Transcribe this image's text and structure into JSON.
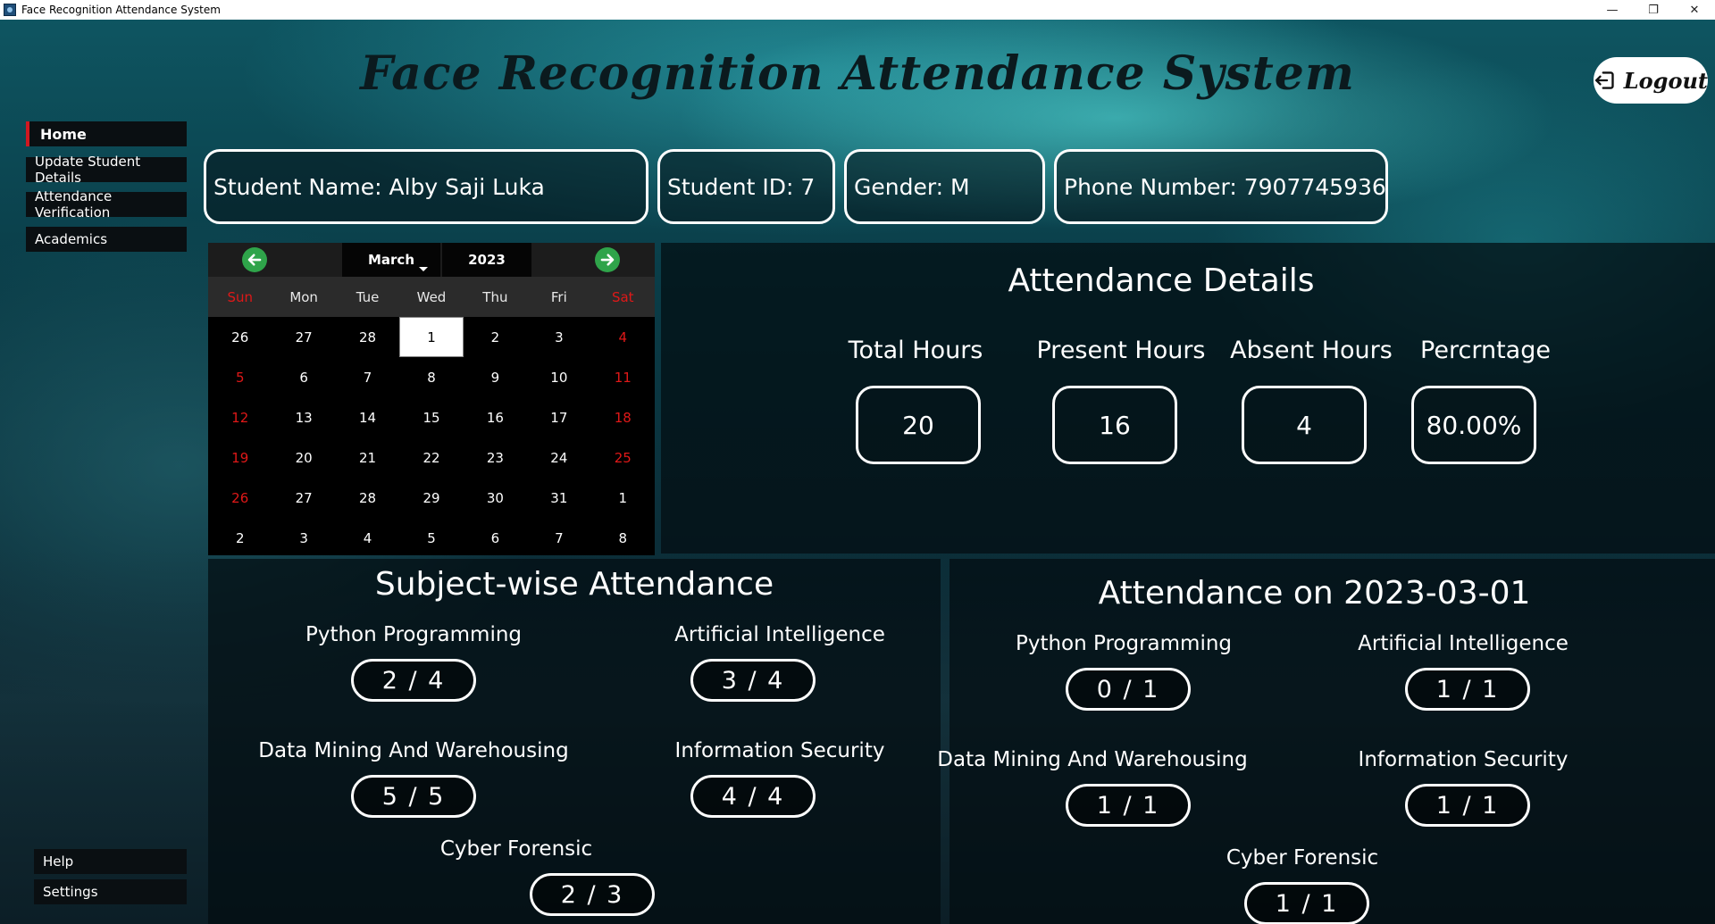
{
  "window": {
    "title": "Face Recognition Attendance System",
    "controls": [
      "—",
      "❐",
      "✕"
    ]
  },
  "header": {
    "title": "Face Recognition Attendance System",
    "logout_label": "Logout"
  },
  "sidebar": {
    "items": [
      {
        "label": "Home",
        "active": true
      },
      {
        "label": "Update Student Details"
      },
      {
        "label": "Attendance Verification"
      },
      {
        "label": "Academics"
      }
    ],
    "bottom": [
      {
        "label": "Help"
      },
      {
        "label": "Settings"
      }
    ]
  },
  "student": {
    "name": "Student Name: Alby Saji Luka",
    "id": "Student ID: 7",
    "gender": "Gender: M",
    "phone": "Phone Number: 7907745936"
  },
  "calendar": {
    "month": "March",
    "year": "2023",
    "weekdays": [
      "Sun",
      "Mon",
      "Tue",
      "Wed",
      "Thu",
      "Fri",
      "Sat"
    ],
    "selected": "1",
    "weeks": [
      [
        "26",
        "27",
        "28",
        "1",
        "2",
        "3",
        "4"
      ],
      [
        "5",
        "6",
        "7",
        "8",
        "9",
        "10",
        "11"
      ],
      [
        "12",
        "13",
        "14",
        "15",
        "16",
        "17",
        "18"
      ],
      [
        "19",
        "20",
        "21",
        "22",
        "23",
        "24",
        "25"
      ],
      [
        "26",
        "27",
        "28",
        "29",
        "30",
        "31",
        "1"
      ],
      [
        "2",
        "3",
        "4",
        "5",
        "6",
        "7",
        "8"
      ]
    ],
    "weekend_color": "#e01818"
  },
  "attendance": {
    "title": "Attendance Details",
    "total_label": "Total Hours",
    "present_label": "Present Hours",
    "absent_label": "Absent Hours",
    "percent_label": "Percrntage",
    "total": "20",
    "present": "16",
    "absent": "4",
    "percent": "80.00%"
  },
  "subject_wise": {
    "title": "Subject-wise Attendance",
    "subjects": [
      {
        "name": "Python Programming",
        "value": "2 / 4"
      },
      {
        "name": "Artificial Intelligence",
        "value": "3 / 4"
      },
      {
        "name": "Data Mining And Warehousing",
        "value": "5 / 5"
      },
      {
        "name": "Information Security",
        "value": "4 / 4"
      },
      {
        "name": "Cyber Forensic",
        "value": "2 / 3"
      }
    ]
  },
  "daily": {
    "title": "Attendance on 2023-03-01",
    "subjects": [
      {
        "name": "Python Programming",
        "value": "0 / 1"
      },
      {
        "name": "Artificial Intelligence",
        "value": "1 / 1"
      },
      {
        "name": "Data Mining And Warehousing",
        "value": "1 / 1"
      },
      {
        "name": "Information Security",
        "value": "1 / 1"
      },
      {
        "name": "Cyber Forensic",
        "value": "1 / 1"
      }
    ]
  },
  "colors": {
    "accent": "#d01820",
    "nav_arrow": "#2fa44a"
  }
}
